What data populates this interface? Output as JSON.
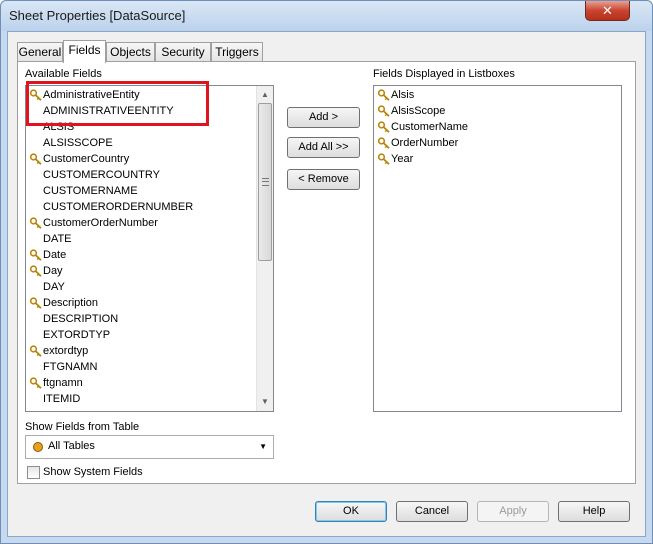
{
  "window": {
    "title": "Sheet Properties [DataSource]",
    "close_glyph": "✕"
  },
  "tabs": [
    {
      "label": "General"
    },
    {
      "label": "Fields",
      "active": true
    },
    {
      "label": "Objects"
    },
    {
      "label": "Security"
    },
    {
      "label": "Triggers"
    }
  ],
  "available": {
    "label": "Available Fields",
    "items": [
      {
        "text": "AdministrativeEntity",
        "key": true,
        "selected": true
      },
      {
        "text": "ADMINISTRATIVEENTITY",
        "key": false
      },
      {
        "text": "ALSIS",
        "key": false
      },
      {
        "text": "ALSISSCOPE",
        "key": false
      },
      {
        "text": "CustomerCountry",
        "key": true
      },
      {
        "text": "CUSTOMERCOUNTRY",
        "key": false
      },
      {
        "text": "CUSTOMERNAME",
        "key": false
      },
      {
        "text": "CUSTOMERORDERNUMBER",
        "key": false
      },
      {
        "text": "CustomerOrderNumber",
        "key": true
      },
      {
        "text": "DATE",
        "key": false
      },
      {
        "text": "Date",
        "key": true
      },
      {
        "text": "Day",
        "key": true
      },
      {
        "text": "DAY",
        "key": false
      },
      {
        "text": "Description",
        "key": true
      },
      {
        "text": "DESCRIPTION",
        "key": false
      },
      {
        "text": "EXTORDTYP",
        "key": false
      },
      {
        "text": "extordtyp",
        "key": true
      },
      {
        "text": "FTGNAMN",
        "key": false
      },
      {
        "text": "ftgnamn",
        "key": true
      },
      {
        "text": "ITEMID",
        "key": false
      }
    ]
  },
  "buttons": {
    "add": "Add >",
    "add_all": "Add All >>",
    "remove": "< Remove",
    "ok": "OK",
    "cancel": "Cancel",
    "apply": "Apply",
    "help": "Help"
  },
  "displayed": {
    "label": "Fields Displayed in Listboxes",
    "items": [
      {
        "text": "Alsis",
        "key": true
      },
      {
        "text": "AlsisScope",
        "key": true
      },
      {
        "text": "CustomerName",
        "key": true
      },
      {
        "text": "OrderNumber",
        "key": true
      },
      {
        "text": "Year",
        "key": true
      }
    ]
  },
  "show_fields": {
    "label": "Show Fields from Table",
    "value": "All Tables"
  },
  "system_fields": {
    "label": "Show System Fields",
    "checked": false
  },
  "colors": {
    "highlight": "#e0141e",
    "key_icon": "#b8860b",
    "combo_dot": "#e8a020"
  },
  "icons": {
    "key": "key-icon",
    "dropdown": "chevron-down-icon",
    "scroll_up": "scroll-up-arrow-icon",
    "scroll_down": "scroll-down-arrow-icon"
  }
}
